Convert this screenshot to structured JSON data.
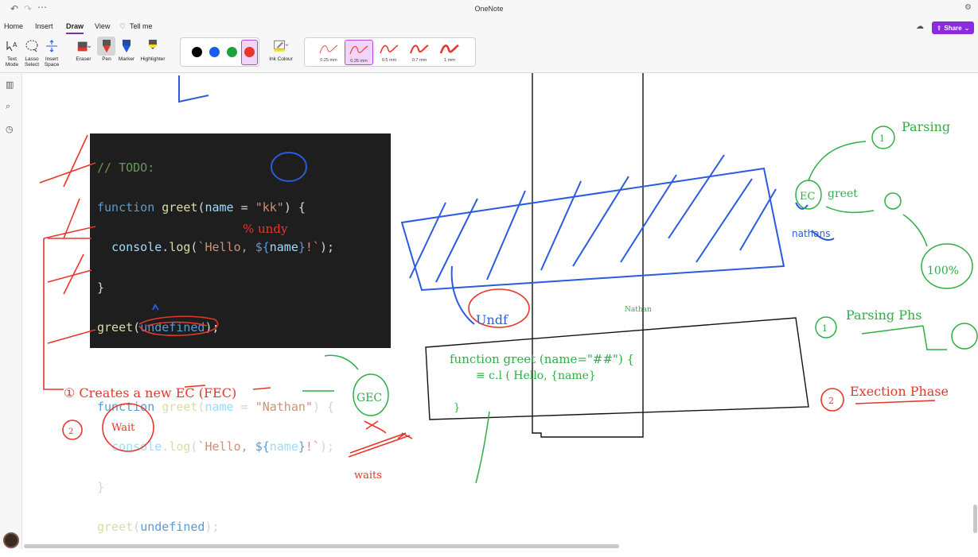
{
  "app": {
    "title": "OneNote"
  },
  "menu": {
    "items": [
      "Home",
      "Insert",
      "Draw",
      "View",
      "Tell me"
    ],
    "active": "Draw",
    "share": "Share"
  },
  "ribbon": {
    "text_mode": "Text Mode",
    "lasso": "Lasso Select",
    "insert_space": "Insert Space",
    "eraser": "Eraser",
    "pen": "Pen",
    "marker": "Marker",
    "highlighter": "Highlighter",
    "ink_colour": "Ink Colour",
    "colors": [
      "#000000",
      "#1a5cf0",
      "#1aa33a",
      "#e8362a"
    ],
    "selected_color": "#e8362a",
    "thickness": [
      "0.25 mm",
      "0.35 mm",
      "0.5 mm",
      "0.7 mm",
      "1 mm"
    ],
    "selected_thickness": "0.35 mm"
  },
  "code": {
    "lines": [
      "// TODO:",
      "function greet(name = \"kk\") {",
      "  console.log(`Hello, ${name}!`);",
      "}",
      "greet(undefined);",
      "",
      "function greet(name = \"Nathan\") {",
      "  console.log(`Hello, ${name}!`);",
      "}",
      "greet(undefined);"
    ]
  },
  "colors": {
    "accent": "#8a2be2",
    "ink_red": "#e8362a",
    "ink_blue": "#2a5be0",
    "ink_green": "#2fae45"
  }
}
